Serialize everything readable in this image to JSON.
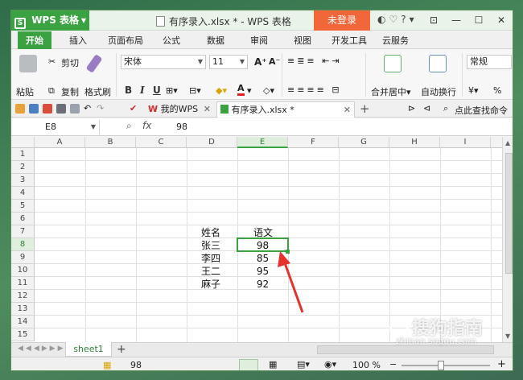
{
  "titlebar": {
    "app_name": "WPS 表格",
    "doc_title": "有序录入.xlsx * - WPS 表格",
    "login_label": "未登录",
    "icons": [
      "skin-icon",
      "menu-icon",
      "help-icon"
    ]
  },
  "menu": {
    "tabs": [
      "开始",
      "插入",
      "页面布局",
      "公式",
      "数据",
      "审阅",
      "视图",
      "开发工具",
      "云服务"
    ]
  },
  "ribbon": {
    "paste": "粘贴",
    "cut": "剪切",
    "copy": "复制",
    "format_painter": "格式刷",
    "font_name": "宋体",
    "font_size": "11",
    "bold": "B",
    "italic": "I",
    "underline": "U",
    "merge_center": "合并居中",
    "wrap_text": "自动换行",
    "number_format": "常规",
    "percent": "%"
  },
  "doc_tabs": {
    "home_tab": "我的WPS",
    "file_tab": "有序录入.xlsx *",
    "search_label": "点此查找命令"
  },
  "formula_bar": {
    "name_box": "E8",
    "fx": "fx",
    "value": "98"
  },
  "sheet": {
    "columns": [
      "A",
      "B",
      "C",
      "D",
      "E",
      "F",
      "G",
      "H",
      "I"
    ],
    "rows": [
      "1",
      "2",
      "3",
      "4",
      "5",
      "6",
      "7",
      "8",
      "9",
      "10",
      "11",
      "12",
      "13",
      "14",
      "15"
    ],
    "header_name": "姓名",
    "header_subject": "语文",
    "names": [
      "张三",
      "李四",
      "王二",
      "麻子"
    ],
    "scores": [
      "98",
      "85",
      "95",
      "92"
    ],
    "selected_cell": "E8"
  },
  "sheet_tabs": {
    "active": "sheet1",
    "add": "+"
  },
  "statusbar": {
    "value": "98",
    "zoom": "100 %",
    "zoom_minus": "−",
    "zoom_plus": "+"
  },
  "watermark": {
    "text": "搜狗指南",
    "url": "zhinan.sogou.com"
  },
  "colors": {
    "accent": "#3aa241",
    "login": "#f2673a",
    "arrow": "#e5322d"
  }
}
